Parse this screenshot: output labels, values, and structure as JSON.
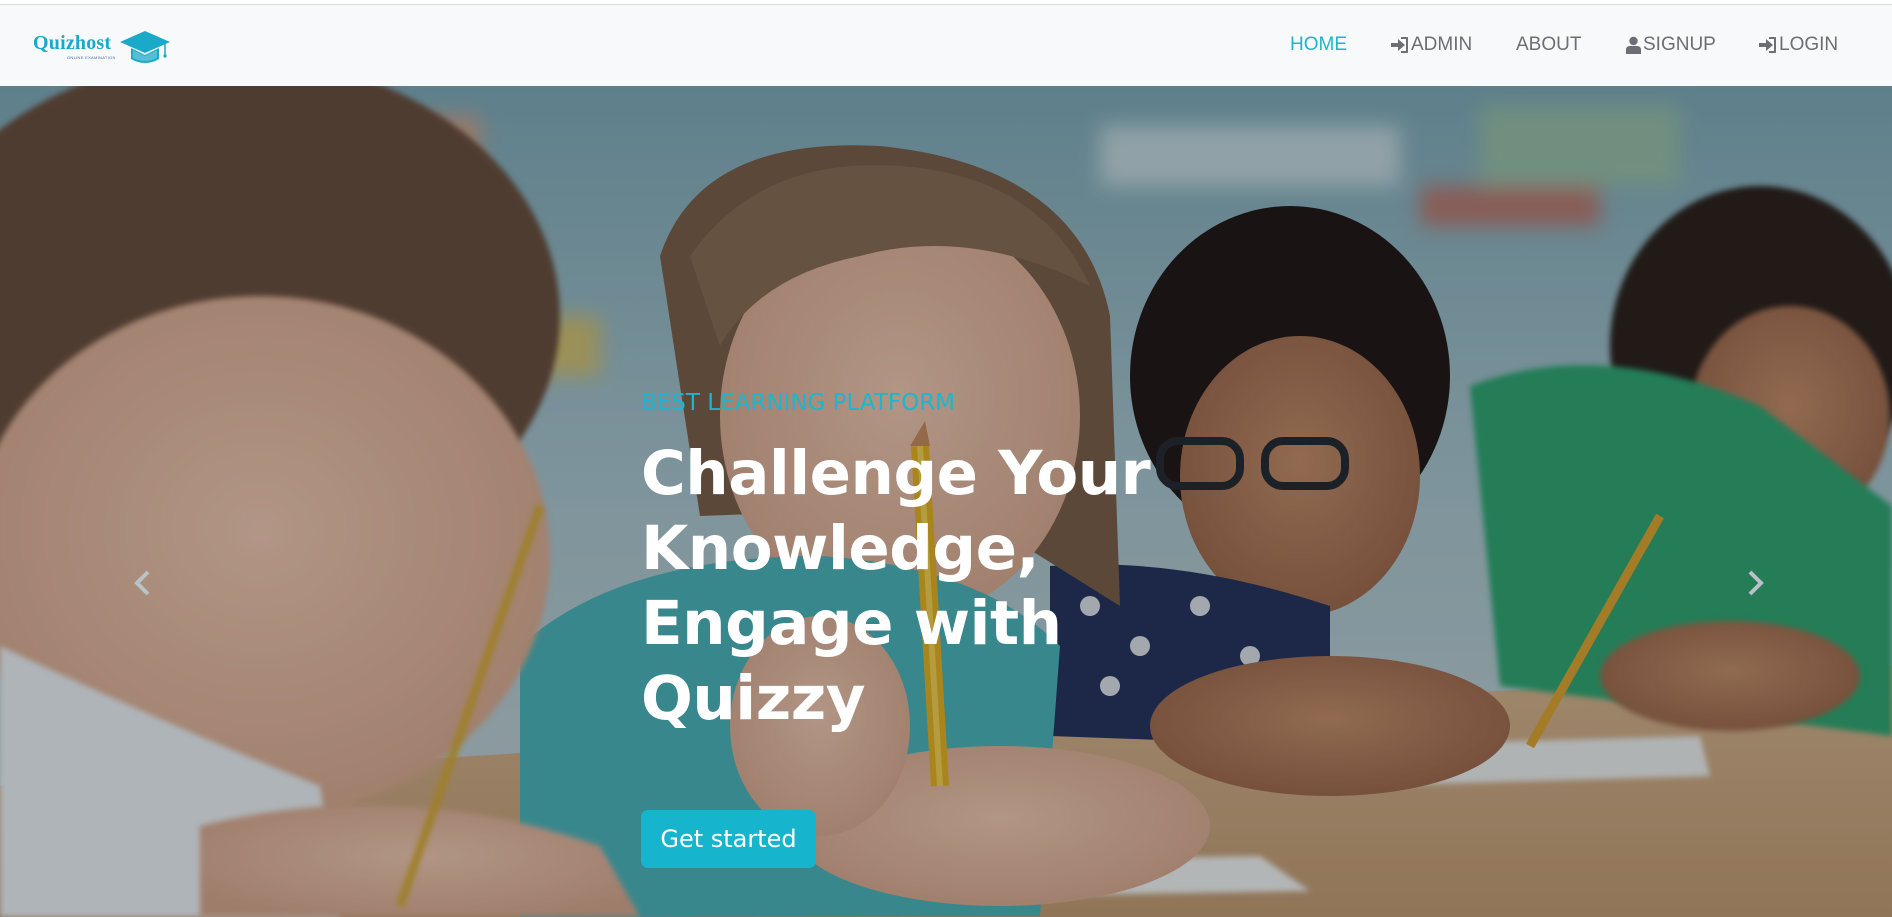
{
  "brand": {
    "name": "Quizhost",
    "tagline": "ONLINE EXAMINATION",
    "accent_color": "#1ab7cf",
    "logo_icon": "graduation-cap-icon"
  },
  "nav": {
    "items": [
      {
        "label": "HOME",
        "icon": "",
        "active": true
      },
      {
        "label": "ADMIN",
        "icon": "sign-in-icon",
        "active": false
      },
      {
        "label": "ABOUT",
        "icon": "",
        "active": false
      },
      {
        "label": "SIGNUP",
        "icon": "user-icon",
        "active": false
      },
      {
        "label": "LOGIN",
        "icon": "sign-in-icon",
        "active": false
      }
    ]
  },
  "hero": {
    "eyebrow": "BEST LEARNING PLATFORM",
    "headline": "Challenge Your Knowledge, Engage with Quizzy",
    "cta_label": "Get started",
    "background": "students-writing-in-classroom",
    "prev_icon": "chevron-left-icon",
    "next_icon": "chevron-right-icon"
  }
}
